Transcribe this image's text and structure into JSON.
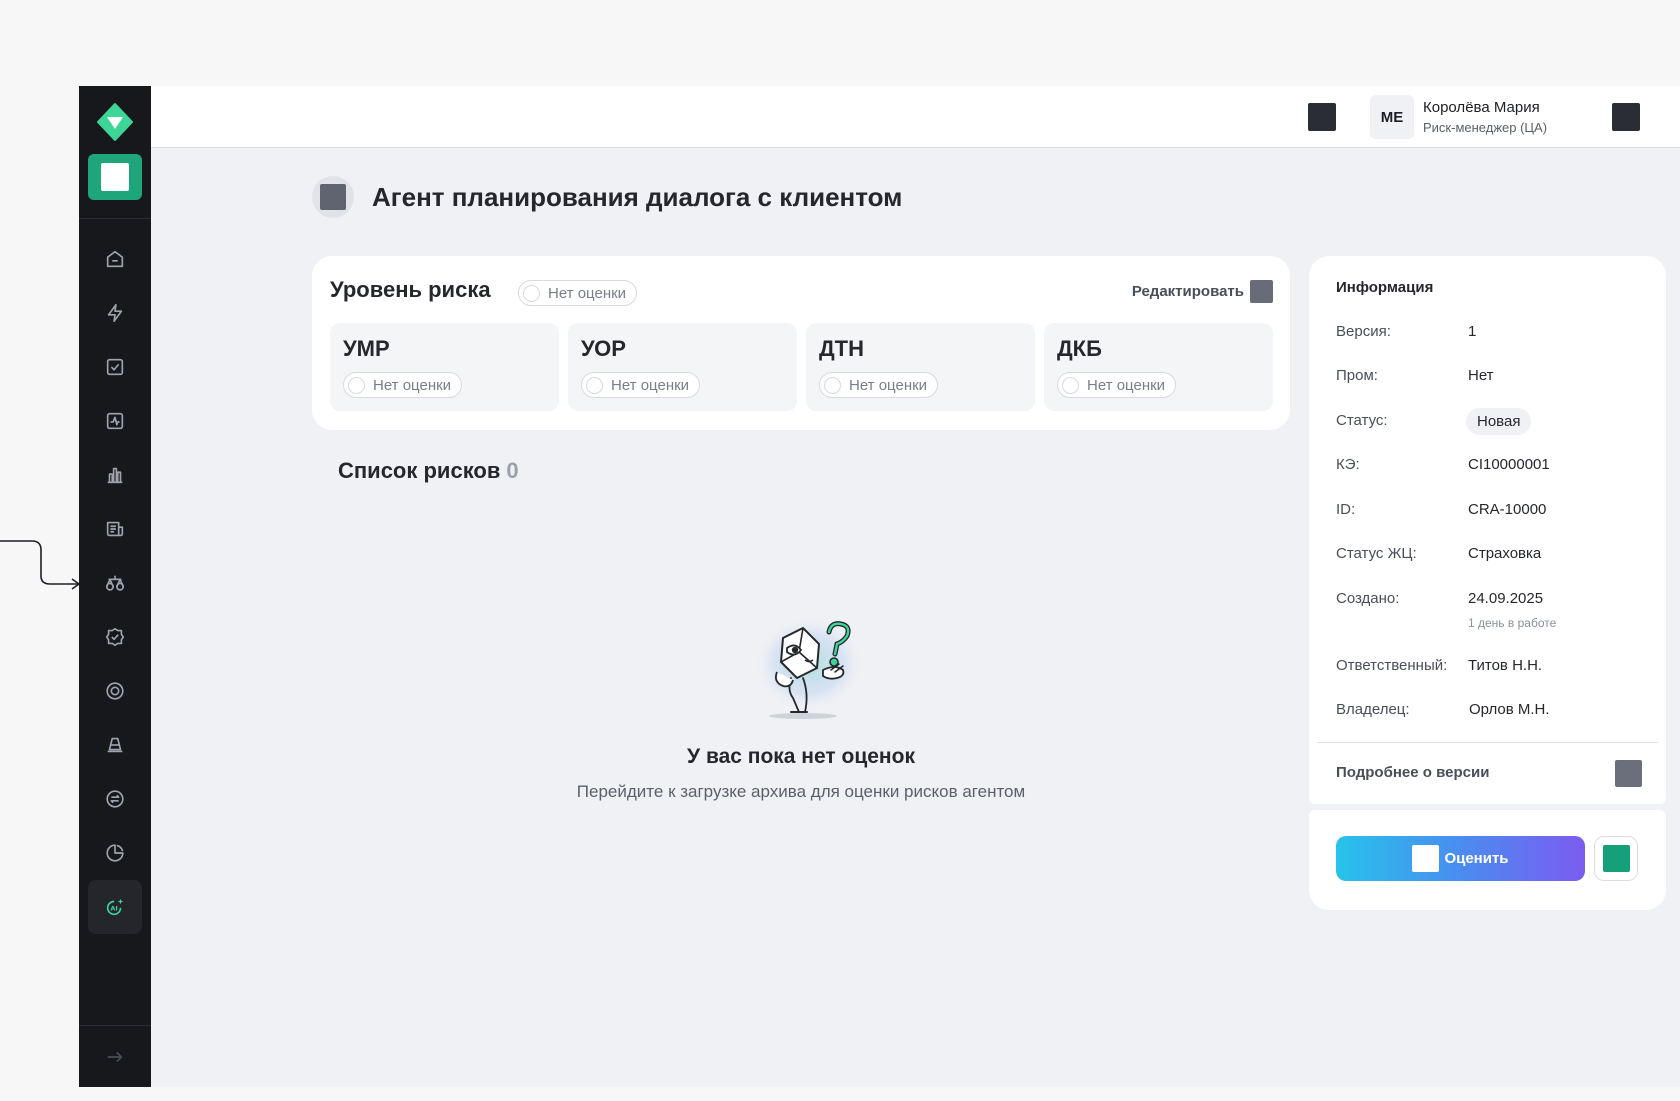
{
  "sidebar": {
    "icons": [
      "home-icon",
      "bolt-icon",
      "checkbox-icon",
      "activity-icon",
      "bar-chart-icon",
      "news-icon",
      "scales-icon",
      "badge-check-icon",
      "target-icon",
      "traffic-cone-icon",
      "exchange-icon",
      "pie-chart-icon",
      "ai-sparkle-icon"
    ],
    "active_item": "ai-sparkle-icon",
    "accent_color": "#1fa57a"
  },
  "header": {
    "avatar_initials": "МЕ",
    "user_name": "Королёва Мария",
    "user_role": "Риск-менеджер (ЦА)"
  },
  "page": {
    "title": "Агент планирования диалога с клиентом"
  },
  "risk_level": {
    "title": "Уровень риска",
    "status": "Нет оценки",
    "edit_label": "Редактировать",
    "tiles": [
      {
        "title": "УМР",
        "status": "Нет оценки"
      },
      {
        "title": "УОР",
        "status": "Нет оценки"
      },
      {
        "title": "ДТН",
        "status": "Нет оценки"
      },
      {
        "title": "ДКБ",
        "status": "Нет оценки"
      }
    ]
  },
  "risks_list": {
    "title": "Список рисков",
    "count": "0",
    "empty_title": "У вас пока нет оценок",
    "empty_subtitle": "Перейдите к загрузке архива для оценки рисков агентом"
  },
  "info": {
    "heading": "Информация",
    "rows": [
      {
        "label": "Версия:",
        "value": "1"
      },
      {
        "label": "Пром:",
        "value": "Нет"
      },
      {
        "label": "Статус:",
        "value": "Новая"
      },
      {
        "label": "КЭ:",
        "value": "CI10000001"
      },
      {
        "label": "ID:",
        "value": "CRA-10000"
      },
      {
        "label": "Статус ЖЦ:",
        "value": "Страховка"
      },
      {
        "label": "Создано:",
        "value": "24.09.2025"
      },
      {
        "label": "Ответственный:",
        "value": "Титов Н.Н."
      },
      {
        "label": "Владелец:",
        "value": "Орлов М.Н."
      }
    ],
    "created_note": "1 день в работе",
    "more_label": "Подробнее о версии"
  },
  "actions": {
    "evaluate_label": "Оценить"
  }
}
